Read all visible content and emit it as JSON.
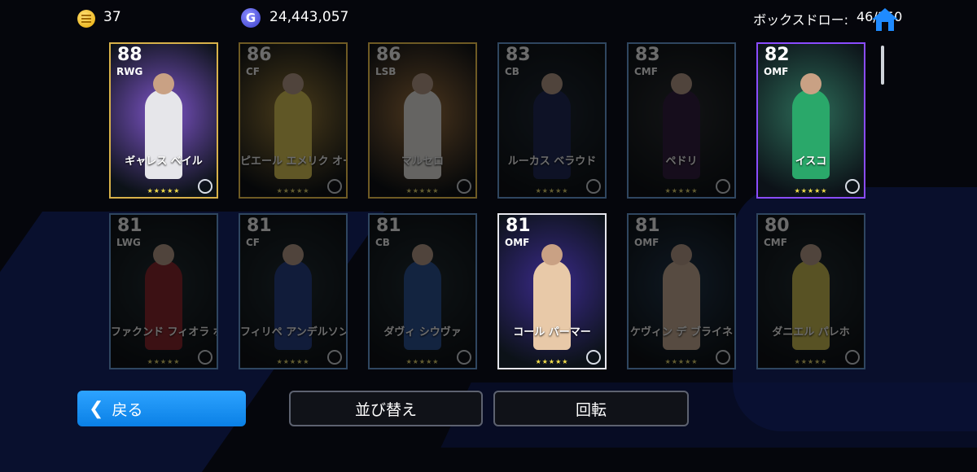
{
  "topbar": {
    "coins": "37",
    "gp": "24,443,057",
    "gp_icon": "G",
    "box_draw_label": "ボックスドロー:",
    "box_draw_count": "46/150"
  },
  "cards": [
    {
      "rating": "88",
      "position": "RWG",
      "name": "ギャレス ベイル",
      "stars": "★★★★★",
      "highlight": "gold",
      "art": "#7e55c9",
      "player": "#e6e6ea"
    },
    {
      "rating": "86",
      "position": "CF",
      "name": "ピエール エメリク オーバメヤング",
      "stars": "★★★★★",
      "highlight": "gold-dim",
      "art": "#b8891e",
      "player": "#f0d22a"
    },
    {
      "rating": "86",
      "position": "LSB",
      "name": "マルセロ",
      "stars": "★★★★★",
      "highlight": "gold-dim",
      "art": "#c07a2a",
      "player": "#f1efe8"
    },
    {
      "rating": "83",
      "position": "CB",
      "name": "ルーカス ベラウド",
      "stars": "★★★★★",
      "highlight": "blue-dim",
      "art": "#1c2b3a",
      "player": "#1c2b6e"
    },
    {
      "rating": "83",
      "position": "CMF",
      "name": "ペドリ",
      "stars": "★★★★★",
      "highlight": "blue-dim",
      "art": "#2a2f33",
      "player": "#3a1d4e"
    },
    {
      "rating": "82",
      "position": "OMF",
      "name": "イスコ",
      "stars": "★★★★★",
      "highlight": "purple",
      "art": "#2d6b58",
      "player": "#2aa86a"
    },
    {
      "rating": "81",
      "position": "LWG",
      "name": "ファクンド フィオラ ボルゴ",
      "stars": "★★★★★",
      "highlight": "blue-dim",
      "art": "#1c2e36",
      "player": "#b2202a"
    },
    {
      "rating": "81",
      "position": "CF",
      "name": "フィリペ アンデルソン デ ブリト",
      "stars": "★★★★★",
      "highlight": "blue-dim",
      "art": "#1c2e36",
      "player": "#1e43a8"
    },
    {
      "rating": "81",
      "position": "CB",
      "name": "ダヴィ シウヴァ",
      "stars": "★★★★★",
      "highlight": "blue-dim",
      "art": "#1c2e36",
      "player": "#1e56b8"
    },
    {
      "rating": "81",
      "position": "OMF",
      "name": "コール パーマー",
      "stars": "★★★★★",
      "highlight": "white",
      "art": "#3a2a8a",
      "player": "#e8c9a8"
    },
    {
      "rating": "81",
      "position": "OMF",
      "name": "ケヴィン デ ブライネ",
      "stars": "★★★★★",
      "highlight": "blue-dim",
      "art": "#1a3a5a",
      "player": "#d9b28e"
    },
    {
      "rating": "80",
      "position": "CMF",
      "name": "ダニエル パレホ",
      "stars": "★★★★★",
      "highlight": "blue-dim",
      "art": "#1c2e36",
      "player": "#d9c52a"
    }
  ],
  "buttons": {
    "back": "戻る",
    "sort": "並び替え",
    "rotate": "回転"
  },
  "colors": {
    "accent": "#0a80e6",
    "star": "#f5e04b"
  }
}
